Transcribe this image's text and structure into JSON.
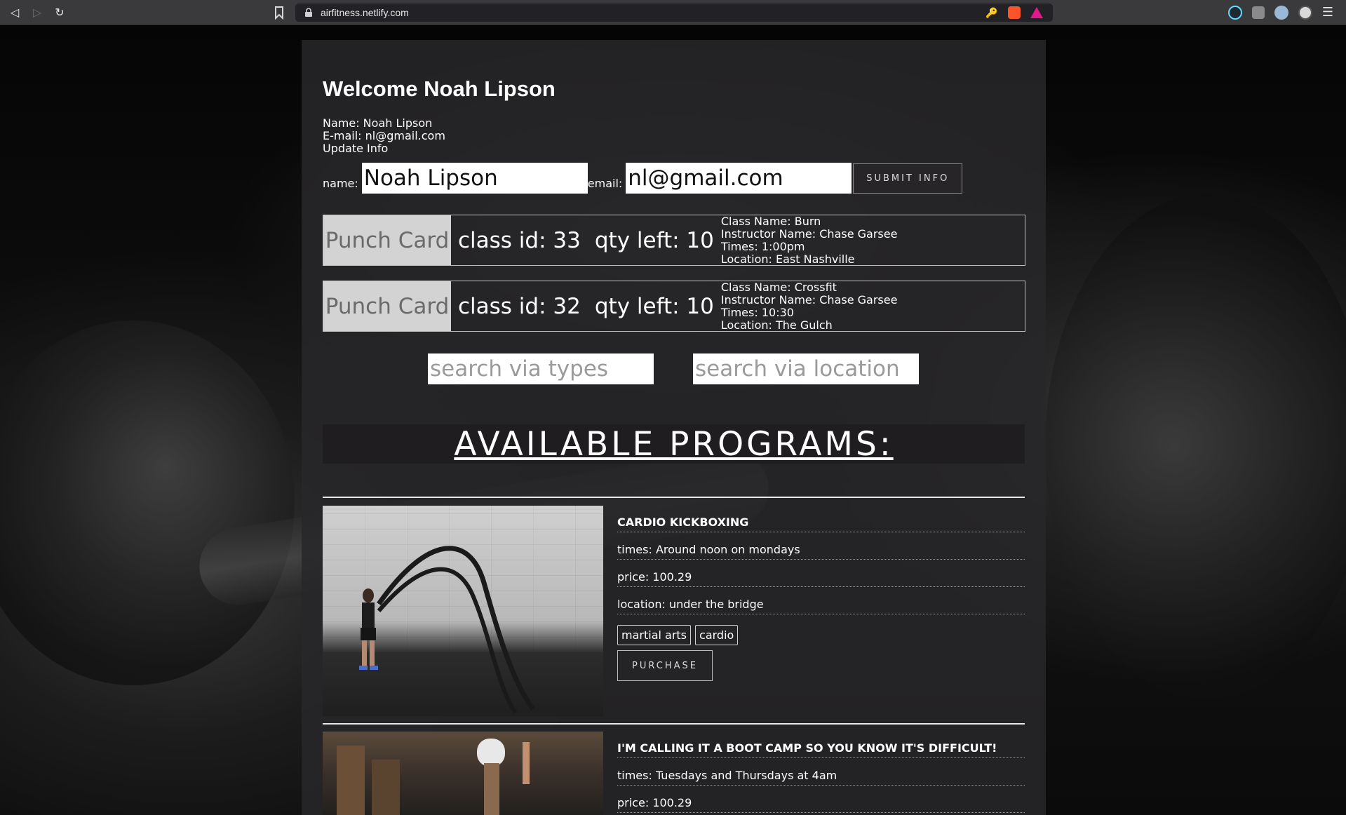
{
  "browser": {
    "url": "airfitness.netlify.com",
    "nav": {
      "back": "back-icon",
      "forward": "forward-icon",
      "reload": "reload-icon"
    }
  },
  "user": {
    "welcome": "Welcome Noah Lipson",
    "name_line": "Name: Noah Lipson",
    "email_line": "E-mail: nl@gmail.com",
    "update_label": "Update Info"
  },
  "form": {
    "name_label": "name:",
    "name_value": "Noah Lipson",
    "email_label": "email:",
    "email_value": "nl@gmail.com",
    "submit_label": "SUBMIT INFO"
  },
  "punch_cards": [
    {
      "button": "Punch Card",
      "class_id": "class id: 33",
      "qty": "qty left: 10",
      "class_name": "Class Name: Burn",
      "instructor": "Instructor Name: Chase Garsee",
      "times": "Times: 1:00pm",
      "location": "Location: East Nashville"
    },
    {
      "button": "Punch Card",
      "class_id": "class id: 32",
      "qty": "qty left: 10",
      "class_name": "Class Name: Crossfit",
      "instructor": "Instructor Name: Chase Garsee",
      "times": "Times: 10:30",
      "location": "Location: The Gulch"
    }
  ],
  "search": {
    "types_placeholder": "search via types",
    "location_placeholder": "search via location"
  },
  "programs_heading": "AVAILABLE PROGRAMS:",
  "programs": [
    {
      "title": "CARDIO KICKBOXING",
      "times": "times: Around noon on mondays",
      "price": "price: 100.29",
      "location": "location: under the bridge",
      "tags": [
        "martial arts",
        "cardio"
      ],
      "purchase_label": "PURCHASE"
    },
    {
      "title": "I'M CALLING IT A BOOT CAMP SO YOU KNOW IT'S DIFFICULT!",
      "times": "times: Tuesdays and Thursdays at 4am",
      "price": "price: 100.29"
    }
  ]
}
